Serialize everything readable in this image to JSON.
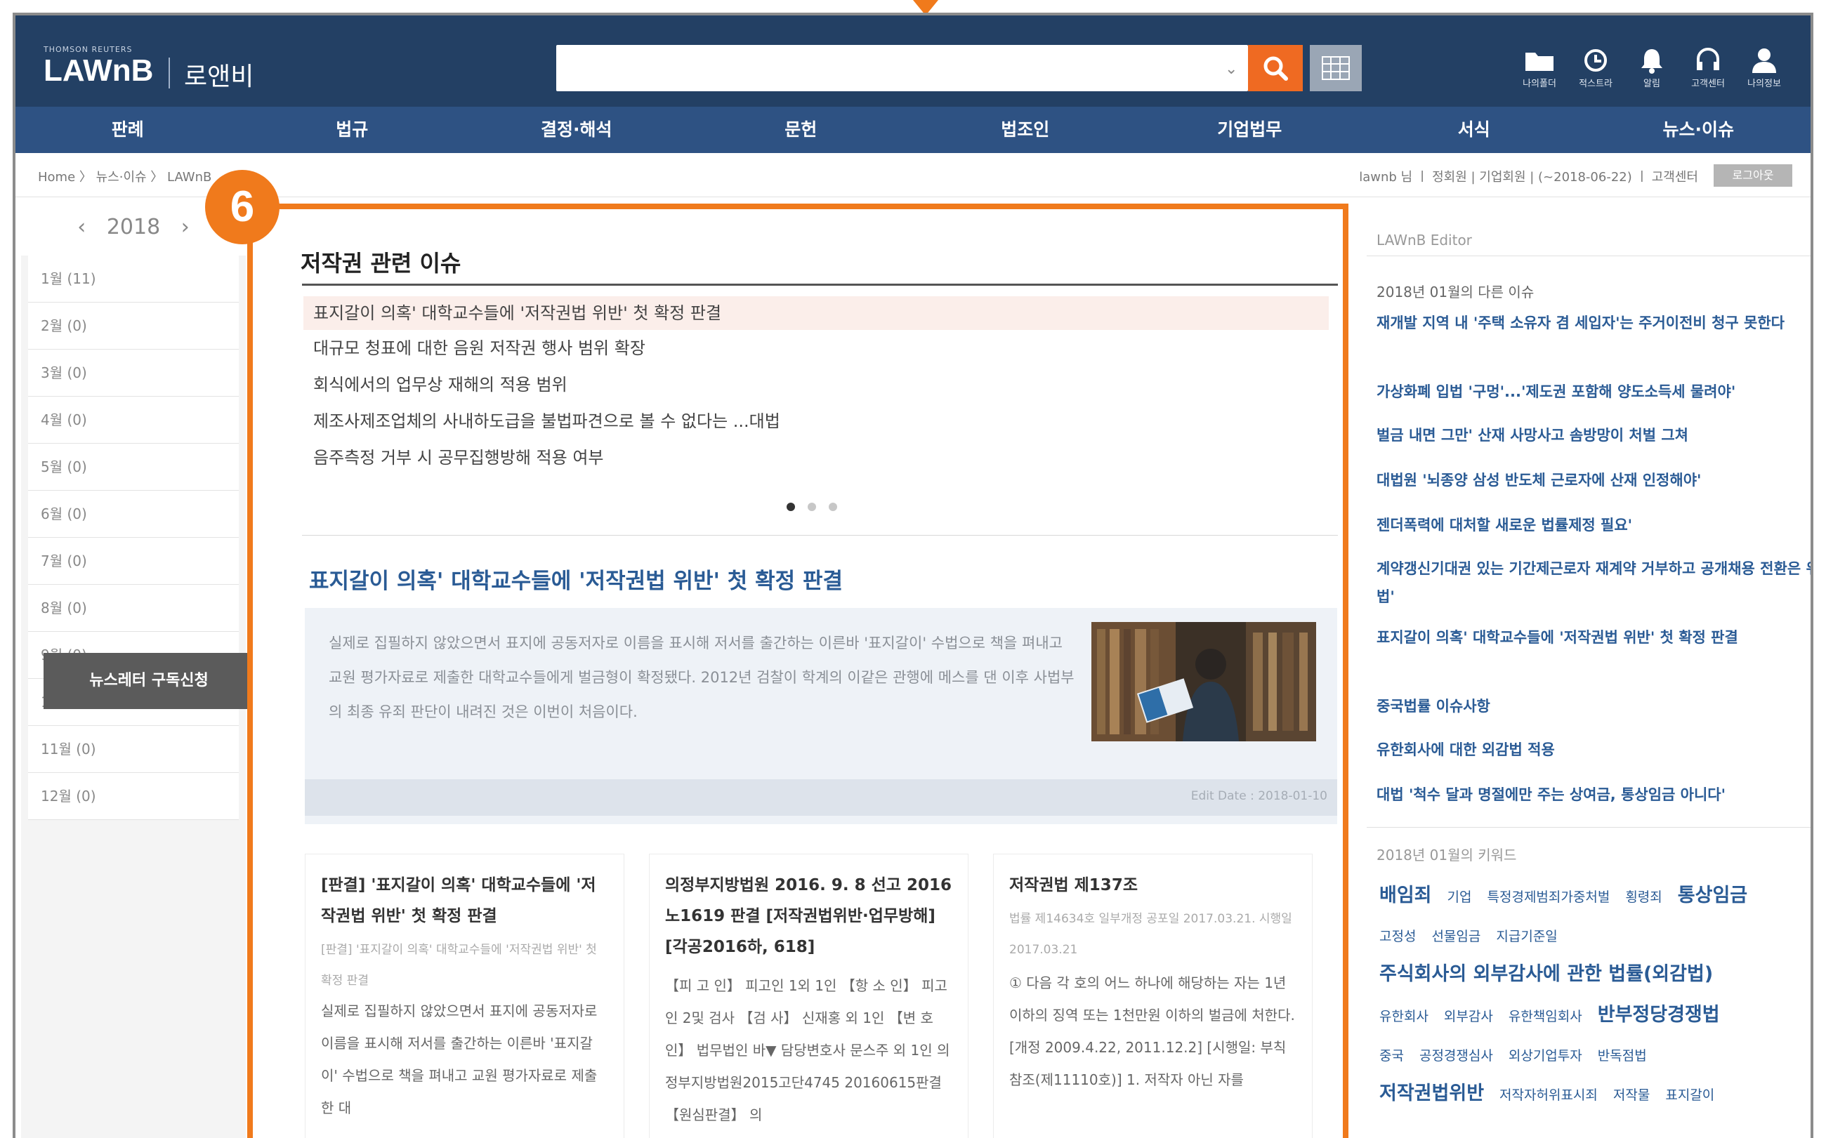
{
  "header": {
    "brand_small": "THOMSON REUTERS",
    "brand": "LAWnB",
    "brand_kr": "로앤비",
    "search": {
      "value": "",
      "placeholder": ""
    },
    "utilities": [
      {
        "icon": "folder-icon",
        "label": "나의폴더"
      },
      {
        "icon": "refresh-icon",
        "label": "적스트라"
      },
      {
        "icon": "bell-icon",
        "label": "알림"
      },
      {
        "icon": "headset-icon",
        "label": "고객센터"
      },
      {
        "icon": "user-icon",
        "label": "나의정보"
      }
    ]
  },
  "nav": [
    "판례",
    "법규",
    "결정·해석",
    "문헌",
    "법조인",
    "기업법무",
    "서식",
    "뉴스·이슈"
  ],
  "infobar": {
    "breadcrumb": "Home 〉 뉴스·이슈 〉 LAWnB",
    "user": "lawnb 님 ㅣ 정회원 | 기업회원 | (~2018-06-22) ㅣ 고객센터",
    "logout": "로그아웃"
  },
  "sidebar": {
    "year": "2018",
    "months": [
      "1월 (11)",
      "2월 (0)",
      "3월 (0)",
      "4월 (0)",
      "5월 (0)",
      "6월 (0)",
      "7월 (0)",
      "8월 (0)",
      "9월 (0)",
      "10월 (0)",
      "11월 (0)",
      "12월 (0)"
    ],
    "subscribe": "뉴스레터 구독신청"
  },
  "badge": "6",
  "main": {
    "section_title": "저작권 관련 이슈",
    "issues": [
      "표지갈이 의혹' 대학교수들에 '저작권법 위반' 첫 확정 판결",
      "대규모 청표에 대한 음원 저작권 행사 범위 확장",
      "회식에서의 업무상 재해의 적용 범위",
      "제조사제조업체의 사내하도급을 불법파견으로 볼 수 없다는 ...대법",
      "음주측정 거부 시 공무집행방해 적용 여부"
    ],
    "feature": {
      "title": "표지갈이 의혹' 대학교수들에 '저작권법 위반' 첫 확정 판결",
      "text": "실제로 집필하지 않았으면서 표지에 공동저자로 이름을 표시해 저서를 출간하는 이른바 '표지갈이' 수법으로 책을 펴내고 교원 평가자료로 제출한 대학교수들에게 벌금형이 확정됐다. 2012년 검찰이 학계의 이같은 관행에 메스를 댄 이후 사법부의 최종 유죄 판단이 내려진 것은 이번이 처음이다.",
      "edit_date": "Edit Date : 2018-01-10"
    },
    "columns": [
      {
        "title": "[판결] '표지갈이 의혹' 대학교수들에 '저작권법 위반' 첫 확정 판결",
        "sub": "[판결] '표지갈이 의혹' 대학교수들에 '저작권법 위반' 첫 확정 판결",
        "body": "실제로 집필하지 않았으면서 표지에 공동저자로 이름을 표시해 저서를 출간하는 이른바 '표지갈이' 수법으로 책을 펴내고 교원 평가자료로 제출한 대"
      },
      {
        "title": "의정부지방법원 2016. 9. 8 선고 2016노1619 판결 [저작권법위반·업무방해] [각공2016하, 618]",
        "sub": "",
        "body": "【피 고 인】 피고인 1외 1인 【항 소 인】 피고인 2및 검사 【검 사】 신재홍 외 1인 【변 호 인】 법무법인 바▼ 담당변호사 문스주 외 1인 의정부지방법원2015고단4745 20160615판결 【원심판결】 의"
      },
      {
        "title": "저작권법 제137조",
        "sub": "법률 제14634호 일부개정 공포일 2017.03.21. 시행일 2017.03.21",
        "body": "① 다음 각 호의 어느 하나에 해당하는 자는 1년 이하의 징역 또는 1천만원 이하의 벌금에 처한다. [개정 2009.4.22, 2011.12.2] [시행일: 부칙참조(제11110호)] 1. 저작자 아닌 자를"
      }
    ]
  },
  "right": {
    "editor_label": "LAWnB Editor",
    "issue_header": "2018년 01월의 다른 이슈",
    "issue_links": [
      "재개발 지역 내 '주택 소유자 겸 세입자'는 주거이전비 청구 못한다",
      "가상화폐 입법 '구멍'...'제도권 포함해 양도소득세 물려야'",
      "벌금 내면 그만' 산재 사망사고 솜방망이 처벌 그쳐",
      "대법원 '뇌종양 삼성 반도체 근로자에 산재 인정해야'",
      "젠더폭력에 대처할 새로운 법률제정 필요'",
      "계약갱신기대권 있는 기간제근로자 재계약 거부하고 공개채용 전환은 위법'",
      "표지갈이 의혹' 대학교수들에 '저작권법 위반' 첫 확정 판결",
      "중국법률 이슈사항",
      "유한회사에 대한 외감법 적용",
      "대법 '척수 달과 명절에만 주는 상여금, 통상임금 아니다'"
    ],
    "keyword_header": "2018년 01월의 키워드",
    "keywords": [
      [
        {
          "t": "배임죄",
          "s": "l"
        },
        {
          "t": "기업",
          "s": "s"
        },
        {
          "t": "특정경제범죄가중처벌",
          "s": "s"
        },
        {
          "t": "횡령죄",
          "s": "s"
        },
        {
          "t": "통상임금",
          "s": "l"
        }
      ],
      [
        {
          "t": "고정성",
          "s": "s"
        },
        {
          "t": "선물임금",
          "s": "s"
        },
        {
          "t": "지급기준일",
          "s": "s"
        }
      ],
      [
        {
          "t": "주식회사의 외부감사에 관한 법률(외감법)",
          "s": "l"
        }
      ],
      [
        {
          "t": "유한회사",
          "s": "s"
        },
        {
          "t": "외부감사",
          "s": "s"
        },
        {
          "t": "유한책임회사",
          "s": "s"
        },
        {
          "t": "반부정당경쟁법",
          "s": "l"
        }
      ],
      [
        {
          "t": "중국",
          "s": "s"
        },
        {
          "t": "공정경쟁심사",
          "s": "s"
        },
        {
          "t": "외상기업투자",
          "s": "s"
        },
        {
          "t": "반독점법",
          "s": "s"
        }
      ],
      [
        {
          "t": "저작권법위반",
          "s": "l"
        },
        {
          "t": "저작자허위표시죄",
          "s": "s"
        },
        {
          "t": "저작물",
          "s": "s"
        },
        {
          "t": "표지갈이",
          "s": "s"
        }
      ]
    ]
  },
  "colors": {
    "header": "#234064",
    "nav": "#2e5283",
    "accent": "#f07a1c",
    "link": "#2a5b95",
    "search_btn": "#ef6a22"
  }
}
